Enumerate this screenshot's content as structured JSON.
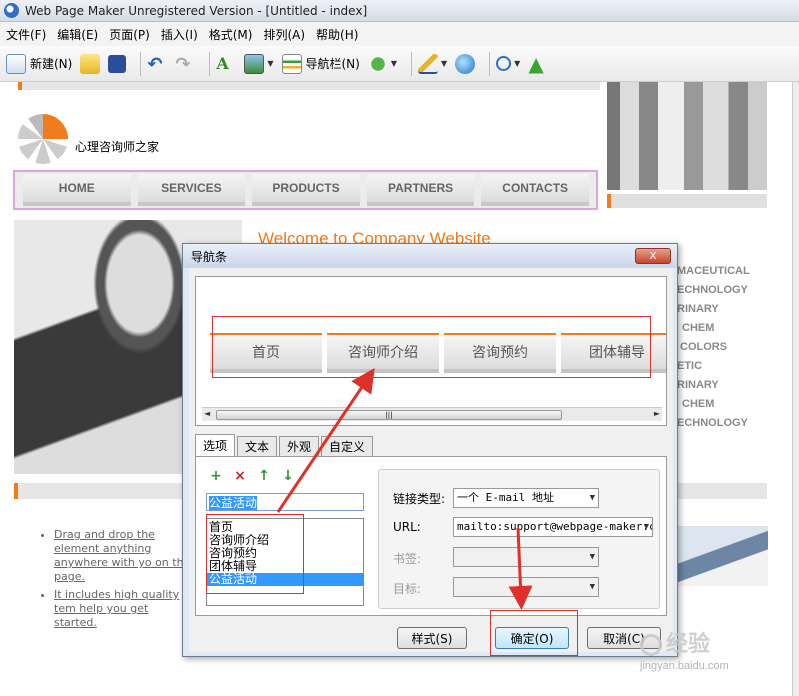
{
  "window": {
    "title": "Web Page Maker Unregistered Version - [Untitled - index]"
  },
  "menu": [
    "文件(F)",
    "编辑(E)",
    "页面(P)",
    "插入(I)",
    "格式(M)",
    "排列(A)",
    "帮助(H)"
  ],
  "toolbar": {
    "new_label": "新建(N)",
    "navbar_label": "导航栏(N)"
  },
  "page": {
    "logo_text": "心理咨询师之家",
    "nav": [
      "HOME",
      "SERVICES",
      "PRODUCTS",
      "PARTNERS",
      "CONTACTS"
    ],
    "welcome": "Welcome to Company Website",
    "right_list": [
      "MACEUTICAL",
      "ECHNOLOGY",
      "RINARY",
      "CHEM",
      "COLORS",
      "ETIC",
      "RINARY",
      "CHEM",
      "ECHNOLOGY"
    ],
    "bullets": [
      "Drag and drop the element anything anywhere with yo on the page.",
      "It includes high quality tem help you get started."
    ]
  },
  "dialog": {
    "title": "导航条",
    "close": "X",
    "preview_items": [
      "首页",
      "咨询师介绍",
      "咨询预约",
      "团体辅导"
    ],
    "tabs": [
      "选项",
      "文本",
      "外观",
      "自定义"
    ],
    "name_value": "公益活动",
    "items": [
      "首页",
      "咨询师介绍",
      "咨询预约",
      "团体辅导",
      "公益活动"
    ],
    "selected_index": 4,
    "link_type_label": "链接类型:",
    "link_type_value": "一个 E-mail 地址",
    "url_label": "URL:",
    "url_value": "mailto:support@webpage-maker.c",
    "bookmark_label": "书签:",
    "target_label": "目标:",
    "style_btn": "样式(S)",
    "ok_btn": "确定(O)",
    "cancel_btn": "取消(C)"
  },
  "watermark": {
    "text": "经验",
    "sub": "jingyan.baidu.com"
  },
  "colors": {
    "accent": "#f07c1c",
    "highlight": "#e0302a",
    "selection": "#3399ff"
  }
}
